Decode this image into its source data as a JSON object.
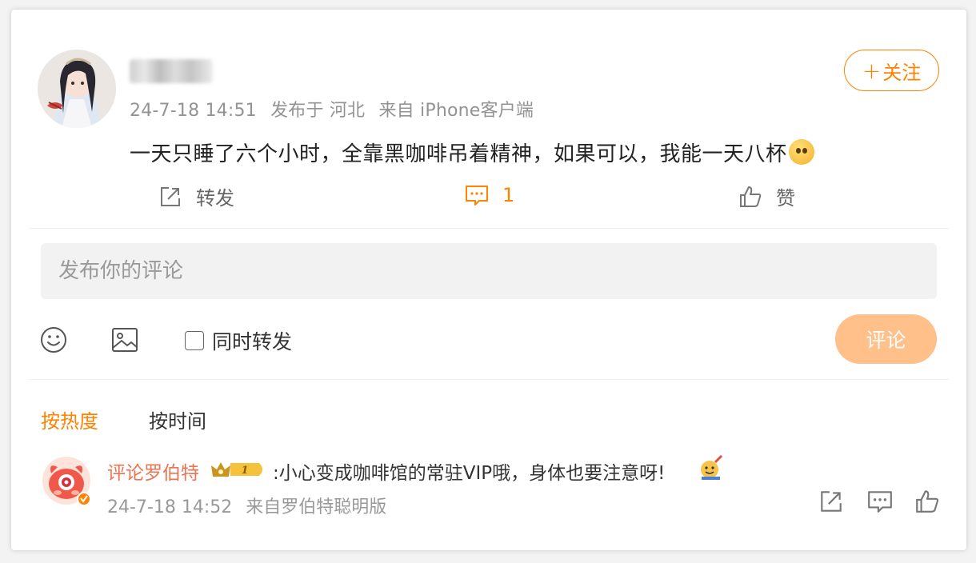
{
  "post": {
    "meta": {
      "time": "24-7-18 14:51",
      "location": "发布于 河北",
      "source": "来自 iPhone客户端"
    },
    "text": "一天只睡了六个小时，全靠黑咖啡吊着精神，如果可以，我能一天八杯",
    "follow_label": "关注",
    "actions": {
      "repost_label": "转发",
      "comment_count": "1",
      "like_label": "赞"
    }
  },
  "composer": {
    "placeholder": "发布你的评论",
    "repost_checkbox_label": "同时转发",
    "submit_label": "评论"
  },
  "sort_tabs": {
    "hot": "按热度",
    "time": "按时间"
  },
  "comment": {
    "author": "评论罗伯特",
    "badge_level": "1",
    "text": ":小心变成咖啡馆的常驻VIP哦，身体也要注意呀!",
    "time": "24-7-18 14:52",
    "source": "来自罗伯特聪明版"
  },
  "colors": {
    "accent": "#ff8200",
    "submit_disabled": "#ffc08a",
    "author_name": "#eb7350",
    "meta_gray": "#939393"
  },
  "icons": {
    "repost": "repost-icon",
    "comment": "comment-icon",
    "like": "thumbs-up-icon",
    "emoji": "smiley-icon",
    "image": "image-icon"
  }
}
